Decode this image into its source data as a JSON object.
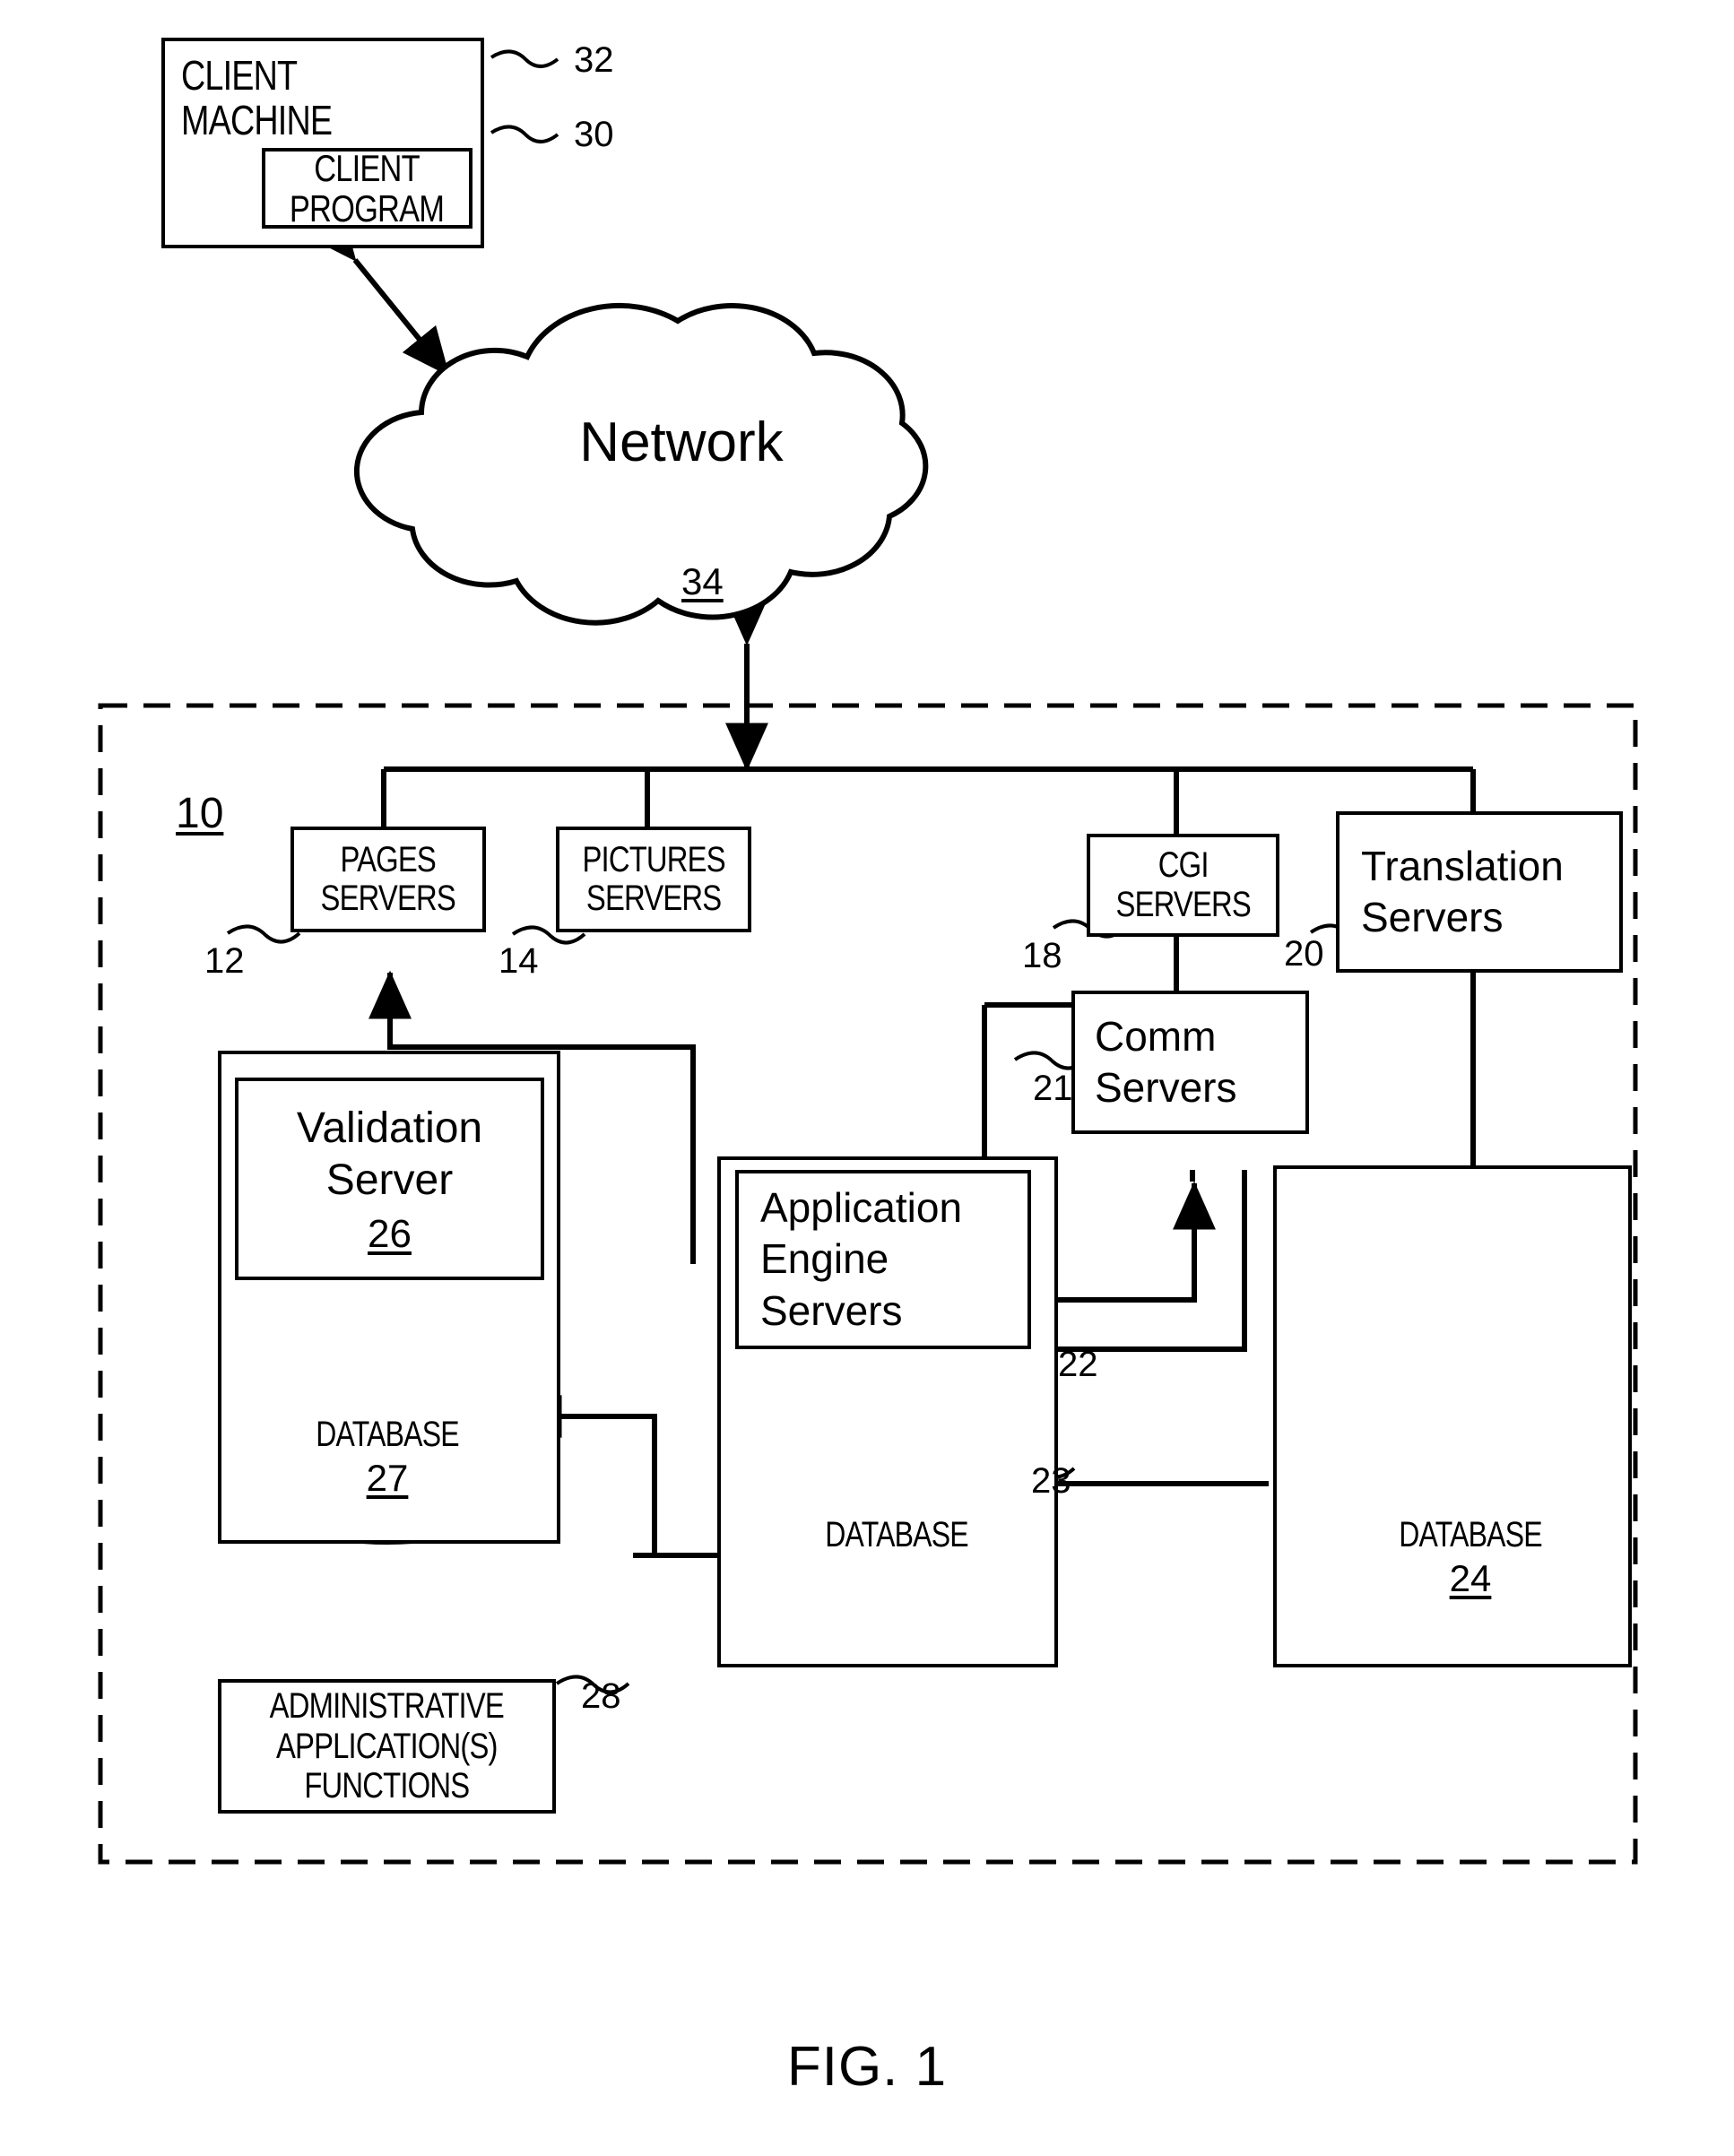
{
  "figure": {
    "caption": "FIG. 1",
    "system_ref": "10"
  },
  "nodes": {
    "client_machine": {
      "label": "CLIENT\nMACHINE",
      "ref": "32"
    },
    "client_program": {
      "label": "CLIENT\nPROGRAM",
      "ref": "30"
    },
    "network": {
      "label": "Network",
      "ref": "34"
    },
    "pages_servers": {
      "label": "PAGES\nSERVERS",
      "ref": "12"
    },
    "pictures_servers": {
      "label": "PICTURES\nSERVERS",
      "ref": "14"
    },
    "cgi_servers": {
      "label": "CGI\nSERVERS",
      "ref": "18"
    },
    "translation_servers": {
      "label": "Translation\nServers",
      "ref": "20"
    },
    "comm_servers": {
      "label": "Comm\nServers",
      "ref": "21"
    },
    "validation_server": {
      "label": "Validation\nServer",
      "ref": "26"
    },
    "validation_database": {
      "label": "DATABASE",
      "ref": "27"
    },
    "app_engine_servers": {
      "label": "Application\nEngine\nServers",
      "ref": "22"
    },
    "app_engine_database": {
      "label": "DATABASE",
      "ref": "23"
    },
    "translation_database": {
      "label": "DATABASE",
      "ref": "24"
    },
    "admin_functions": {
      "label": "ADMINISTRATIVE\nAPPLICATION(S)\nFUNCTIONS",
      "ref": "28"
    }
  },
  "colors": {
    "line": "#000000",
    "background": "#ffffff"
  }
}
